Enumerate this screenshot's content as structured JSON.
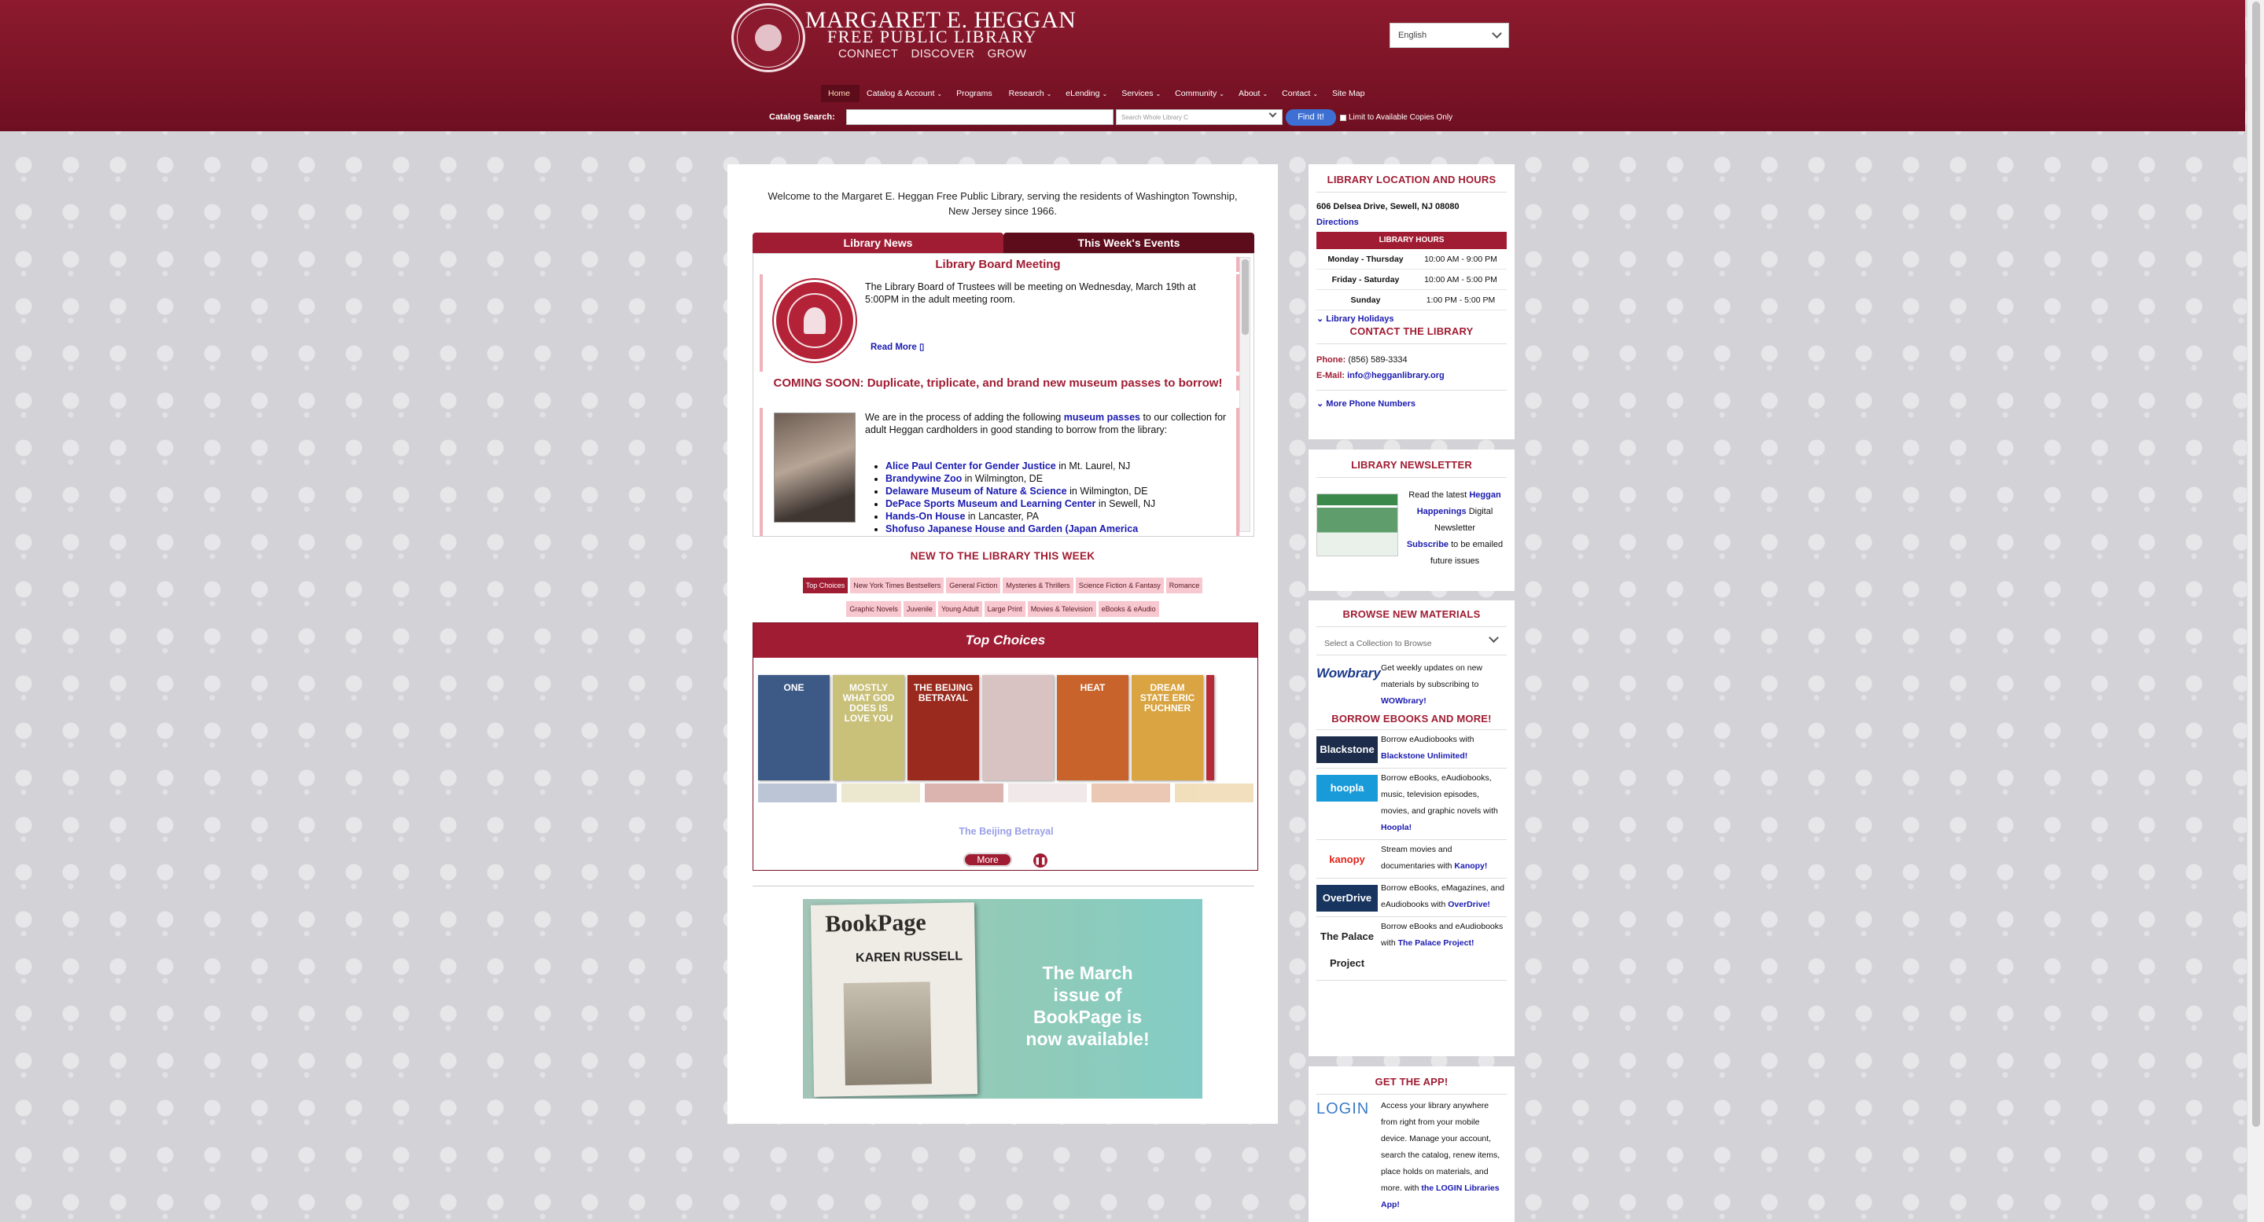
{
  "header": {
    "logo_name": "MARGARET E. HEGGAN",
    "logo_sub": "FREE PUBLIC LIBRARY",
    "tagline": "CONNECT DISCOVER GROW",
    "language": "English"
  },
  "nav": [
    {
      "label": "Home",
      "dd": ""
    },
    {
      "label": "Catalog & Account",
      "dd": "⌄"
    },
    {
      "label": "Programs",
      "dd": ""
    },
    {
      "label": "Research",
      "dd": "⌄"
    },
    {
      "label": "eLending",
      "dd": "⌄"
    },
    {
      "label": "Services",
      "dd": "⌄"
    },
    {
      "label": "Community",
      "dd": "⌄"
    },
    {
      "label": "About",
      "dd": "⌄"
    },
    {
      "label": "Contact",
      "dd": "⌄"
    },
    {
      "label": "Site Map",
      "dd": ""
    }
  ],
  "search": {
    "label": "Catalog Search:",
    "scope_placeholder": "Search Whole Library C",
    "button": "Find It!",
    "available_only": "Limit to Available Copies Only"
  },
  "main": {
    "welcome": "Welcome to the Margaret E. Heggan Free Public Library, serving the residents of Washington Township, New Jersey since 1966.",
    "tab_news": "Library News",
    "tab_events": "This Week's Events",
    "article1": {
      "title": "Library Board Meeting",
      "text": "The Library Board of Trustees will be meeting on Wednesday, March 19th at 5:00PM in the adult meeting room.",
      "read_more": "Read More ▯"
    },
    "article2": {
      "title": "COMING SOON: Duplicate, triplicate, and brand new museum passes to borrow!",
      "intro_a": "We are in the process of adding the following ",
      "intro_link": "museum passes",
      "intro_b": " to our collection for adult Heggan cardholders in good standing to borrow from the library:",
      "passes": [
        {
          "name": "Alice Paul Center for Gender Justice",
          "loc": " in Mt. Laurel, NJ"
        },
        {
          "name": "Brandywine Zoo",
          "loc": " in Wilmington, DE"
        },
        {
          "name": "Delaware Museum of Nature & Science",
          "loc": " in Wilmington, DE"
        },
        {
          "name": "DePace Sports Museum and Learning Center",
          "loc": " in Sewell, NJ"
        },
        {
          "name": "Hands-On House",
          "loc": " in Lancaster, PA"
        },
        {
          "name": "Shofuso Japanese House and Garden (Japan America",
          "loc": ""
        }
      ]
    },
    "new_heading": "NEW TO THE LIBRARY THIS WEEK",
    "chips_row1": [
      "Top Choices",
      "New York Times Bestsellers",
      "General Fiction",
      "Mysteries & Thrillers",
      "Science Fiction & Fantasy",
      "Romance"
    ],
    "chips_row2": [
      "Graphic Novels",
      "Juvenile",
      "Young Adult",
      "Large Print",
      "Movies & Television",
      "eBooks & eAudio"
    ],
    "carousel_title": "Top Choices",
    "covers": [
      {
        "text": "ONE",
        "color": "#3d5a86"
      },
      {
        "text": "MOSTLY WHAT GOD DOES IS LOVE YOU",
        "color": "#c9c07a"
      },
      {
        "text": "THE BEIJING BETRAYAL",
        "color": "#9a2a1e"
      },
      {
        "text": "",
        "color": "#d9c2c2"
      },
      {
        "text": "HEAT",
        "color": "#c8632c"
      },
      {
        "text": "DREAM STATE ERIC PUCHNER",
        "color": "#d9a441"
      }
    ],
    "current_title": "The Beijing Betrayal",
    "more_button": "More",
    "pause_icon": "❚❚",
    "bookpage": {
      "masthead": "BookPage",
      "author": "KAREN RUSSELL",
      "message": "The March issue of BookPage is now available!"
    }
  },
  "sidebar": {
    "location_heading": "LIBRARY LOCATION AND HOURS",
    "address": "606 Delsea Drive, Sewell, NJ 08080",
    "directions": "Directions",
    "hours_heading": "LIBRARY HOURS",
    "hours": [
      {
        "day": "Monday - Thursday",
        "time": "10:00 AM - 9:00 PM"
      },
      {
        "day": "Friday - Saturday",
        "time": "10:00 AM - 5:00 PM"
      },
      {
        "day": "Sunday",
        "time": "1:00 PM - 5:00 PM"
      }
    ],
    "holidays": "Library Holidays",
    "contact_heading": "CONTACT THE LIBRARY",
    "phone_label": "Phone:",
    "phone": "(856) 589-3334",
    "email_label": "E-Mail:",
    "email": "info@hegganlibrary.org",
    "more_phones": "More Phone Numbers",
    "newsletter_heading": "LIBRARY NEWSLETTER",
    "newsletter_a": "Read the latest ",
    "newsletter_link": "Heggan Happenings",
    "newsletter_b": " Digital Newsletter",
    "subscribe_link": "Subscribe",
    "subscribe_b": " to be emailed future issues",
    "browse_heading": "BROWSE NEW MATERIALS",
    "browse_placeholder": "Select a Collection to Browse",
    "wowbrary_logo": "Wowbrary",
    "wowbrary_text": "Get weekly updates on new materials by subscribing to ",
    "wowbrary_link": "WOWbrary!",
    "borrow_heading": "BORROW EBOOKS AND MORE!",
    "resources": [
      {
        "logo": "Blackstone",
        "bg": "#1c2c4a",
        "fg": "#ffffff",
        "text": "Borrow eAudiobooks with ",
        "link": "Blackstone Unlimited!"
      },
      {
        "logo": "hoopla",
        "bg": "#1a9bd9",
        "fg": "#ffffff",
        "text": "Borrow eBooks, eAudiobooks, music, television episodes, movies, and graphic novels with ",
        "link": "Hoopla!"
      },
      {
        "logo": "kanopy",
        "bg": "#ffffff",
        "fg": "#e2231a",
        "text": "Stream movies and documentaries with ",
        "link": "Kanopy!"
      },
      {
        "logo": "OverDrive",
        "bg": "#17355f",
        "fg": "#ffffff",
        "text": "Borrow eBooks, eMagazines, and eAudiobooks with ",
        "link": "OverDrive!"
      },
      {
        "logo": "The Palace Project",
        "bg": "#ffffff",
        "fg": "#222222",
        "text": "Borrow eBooks and eAudiobooks with ",
        "link": "The Palace Project!"
      }
    ],
    "app_heading": "GET THE APP!",
    "app_logo": "LOGIN",
    "app_text": "Access your library anywhere from right from your mobile device. Manage your account, search the catalog, renew items, place holds on materials, and more. with ",
    "app_link": "the LOGIN Libraries App!"
  },
  "colors": {
    "brand": "#a01c33",
    "brand_dark": "#6e0f21",
    "link": "#1a1ab0"
  }
}
